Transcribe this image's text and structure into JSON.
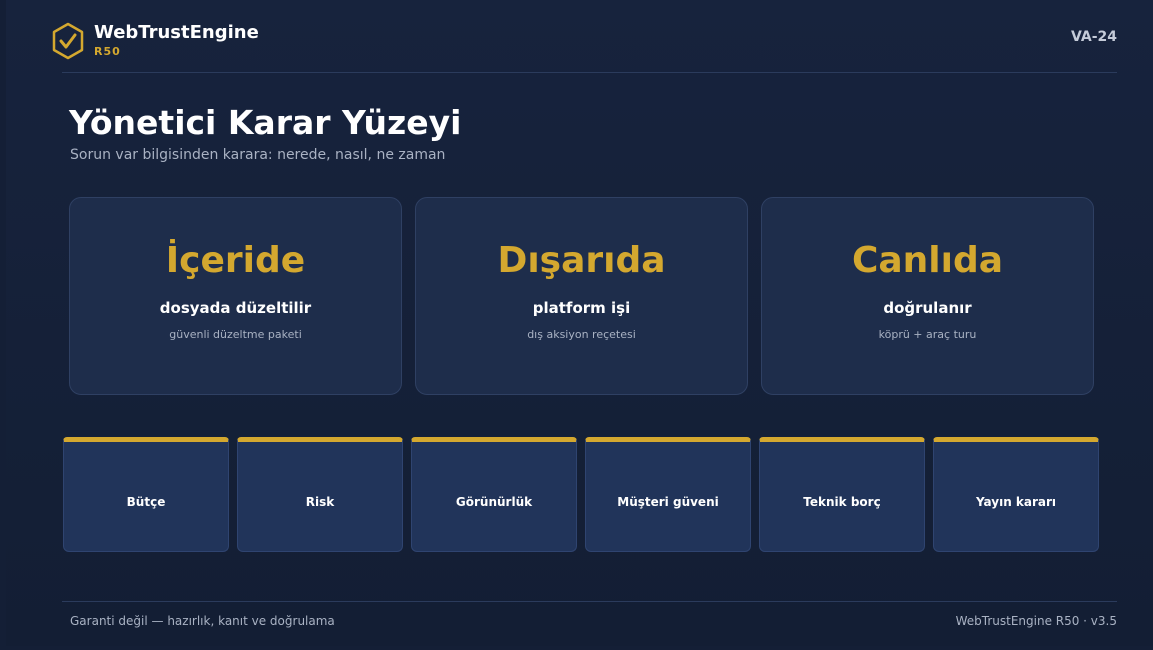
{
  "header": {
    "brand_name": "WebTrustEngine",
    "brand_sub": "R50",
    "version_tag": "VA-24",
    "logo_icon": "shield-check-icon",
    "accent_color": "#d4a82f"
  },
  "main": {
    "title": "Yönetici Karar Yüzeyi",
    "subtitle": "Sorun var bilgisinden karara: nerede, nasıl, ne zaman",
    "cards": [
      {
        "title": "İçeride",
        "subtitle": "dosyada düzeltilir",
        "caption": "güvenli düzeltme paketi"
      },
      {
        "title": "Dışarıda",
        "subtitle": "platform işi",
        "caption": "dış aksiyon reçetesi"
      },
      {
        "title": "Canlıda",
        "subtitle": "doğrulanır",
        "caption": "köprü + araç turu"
      }
    ],
    "tiles": [
      {
        "label": "Bütçe"
      },
      {
        "label": "Risk"
      },
      {
        "label": "Görünürlük"
      },
      {
        "label": "Müşteri güveni"
      },
      {
        "label": "Teknik borç"
      },
      {
        "label": "Yayın kararı"
      }
    ]
  },
  "footer": {
    "left": "Garanti değil — hazırlık, kanıt ve doğrulama",
    "right": "WebTrustEngine R50 · v3.5"
  }
}
